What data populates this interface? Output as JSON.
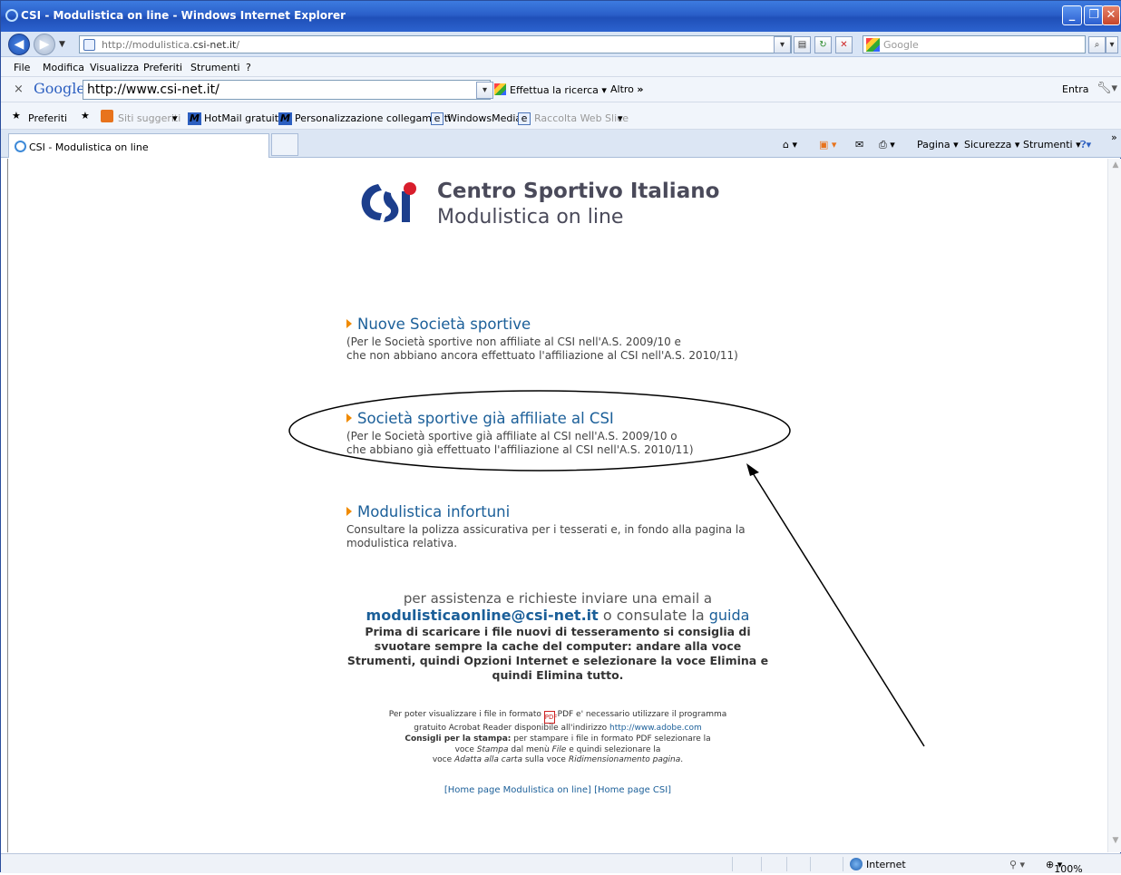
{
  "window": {
    "title": "CSI - Modulistica on line - Windows Internet Explorer",
    "controls": [
      "minimize",
      "maximize",
      "close"
    ]
  },
  "address_bar": {
    "url_prefix": "http://modulistica.",
    "url_domain": "csi-net.it",
    "url_suffix": "/",
    "search_placeholder": "Google"
  },
  "menu": {
    "items": [
      "File",
      "Modifica",
      "Visualizza",
      "Preferiti",
      "Strumenti",
      "?"
    ]
  },
  "google_toolbar": {
    "logo": "Google",
    "query": "http://www.csi-net.it/",
    "search_label": "Effettua la ricerca",
    "more_label": "Altro",
    "signin_label": "Entra"
  },
  "favorites_bar": {
    "favorites_label": "Preferiti",
    "items": [
      {
        "label": "Siti suggeriti",
        "dim": true
      },
      {
        "label": "HotMail gratuita",
        "dim": false
      },
      {
        "label": "Personalizzazione collegamenti",
        "dim": false
      },
      {
        "label": "WindowsMedia",
        "dim": false
      },
      {
        "label": "Raccolta Web Slice",
        "dim": true
      }
    ]
  },
  "tabs": {
    "active_tab": "CSI - Modulistica on line",
    "commands": [
      "Pagina",
      "Sicurezza",
      "Strumenti"
    ]
  },
  "page": {
    "title": "Centro Sportivo Italiano",
    "subtitle": "Modulistica on line",
    "sections": [
      {
        "heading": "Nuove Società sportive",
        "lines": [
          "(Per le Società sportive non affiliate al CSI nell'A.S. 2009/10 e",
          "che non abbiano ancora effettuato l'affiliazione al CSI nell'A.S. 2010/11)"
        ]
      },
      {
        "heading": "Società sportive già affiliate al CSI",
        "lines": [
          "(Per le Società sportive già affiliate al CSI nell'A.S. 2009/10 o",
          "che abbiano già effettuato l'affiliazione al CSI nell'A.S. 2010/11)"
        ]
      },
      {
        "heading": "Modulistica infortuni",
        "lines": [
          "Consultare la polizza assicurativa per i tesserati e, in fondo alla pagina la",
          "modulistica relativa."
        ]
      }
    ],
    "assistance": {
      "line1": "per assistenza e richieste inviare una email a",
      "email": "modulisticaonline@csi-net.it",
      "or_text": "o consulate la",
      "guide_link": "guida",
      "warning": [
        "Prima di scaricare i file nuovi di tesseramento si consiglia di",
        "svuotare sempre la cache del computer: andare alla voce",
        "Strumenti, quindi Opzioni Internet e selezionare la voce Elimina e",
        "quindi Elimina tutto."
      ]
    },
    "pdf_note": {
      "p1": "Per poter visualizzare i file in formato",
      "p2": "PDF e' necessario utilizzare il programma",
      "p3": "gratuito Acrobat Reader disponibile all'indirizzo",
      "adobe_link": "http://www.adobe.com",
      "print_label": "Consigli per la stampa:",
      "p4": "per stampare i file in formato PDF selezionare la",
      "p5a": "voce",
      "p5b": "Stampa",
      "p5c": "dal menù",
      "p5d": "File",
      "p5e": "e quindi selezionare la",
      "p6a": "voce",
      "p6b": "Adatta alla carta",
      "p6c": "sulla voce",
      "p6d": "Ridimensionamento pagina",
      "p6e": "."
    },
    "footer_links": {
      "home_modulistica": "[Home page Modulistica on line]",
      "home_csi": "[Home page CSI]"
    }
  },
  "status_bar": {
    "zone": "Internet",
    "zoom": "100%"
  }
}
